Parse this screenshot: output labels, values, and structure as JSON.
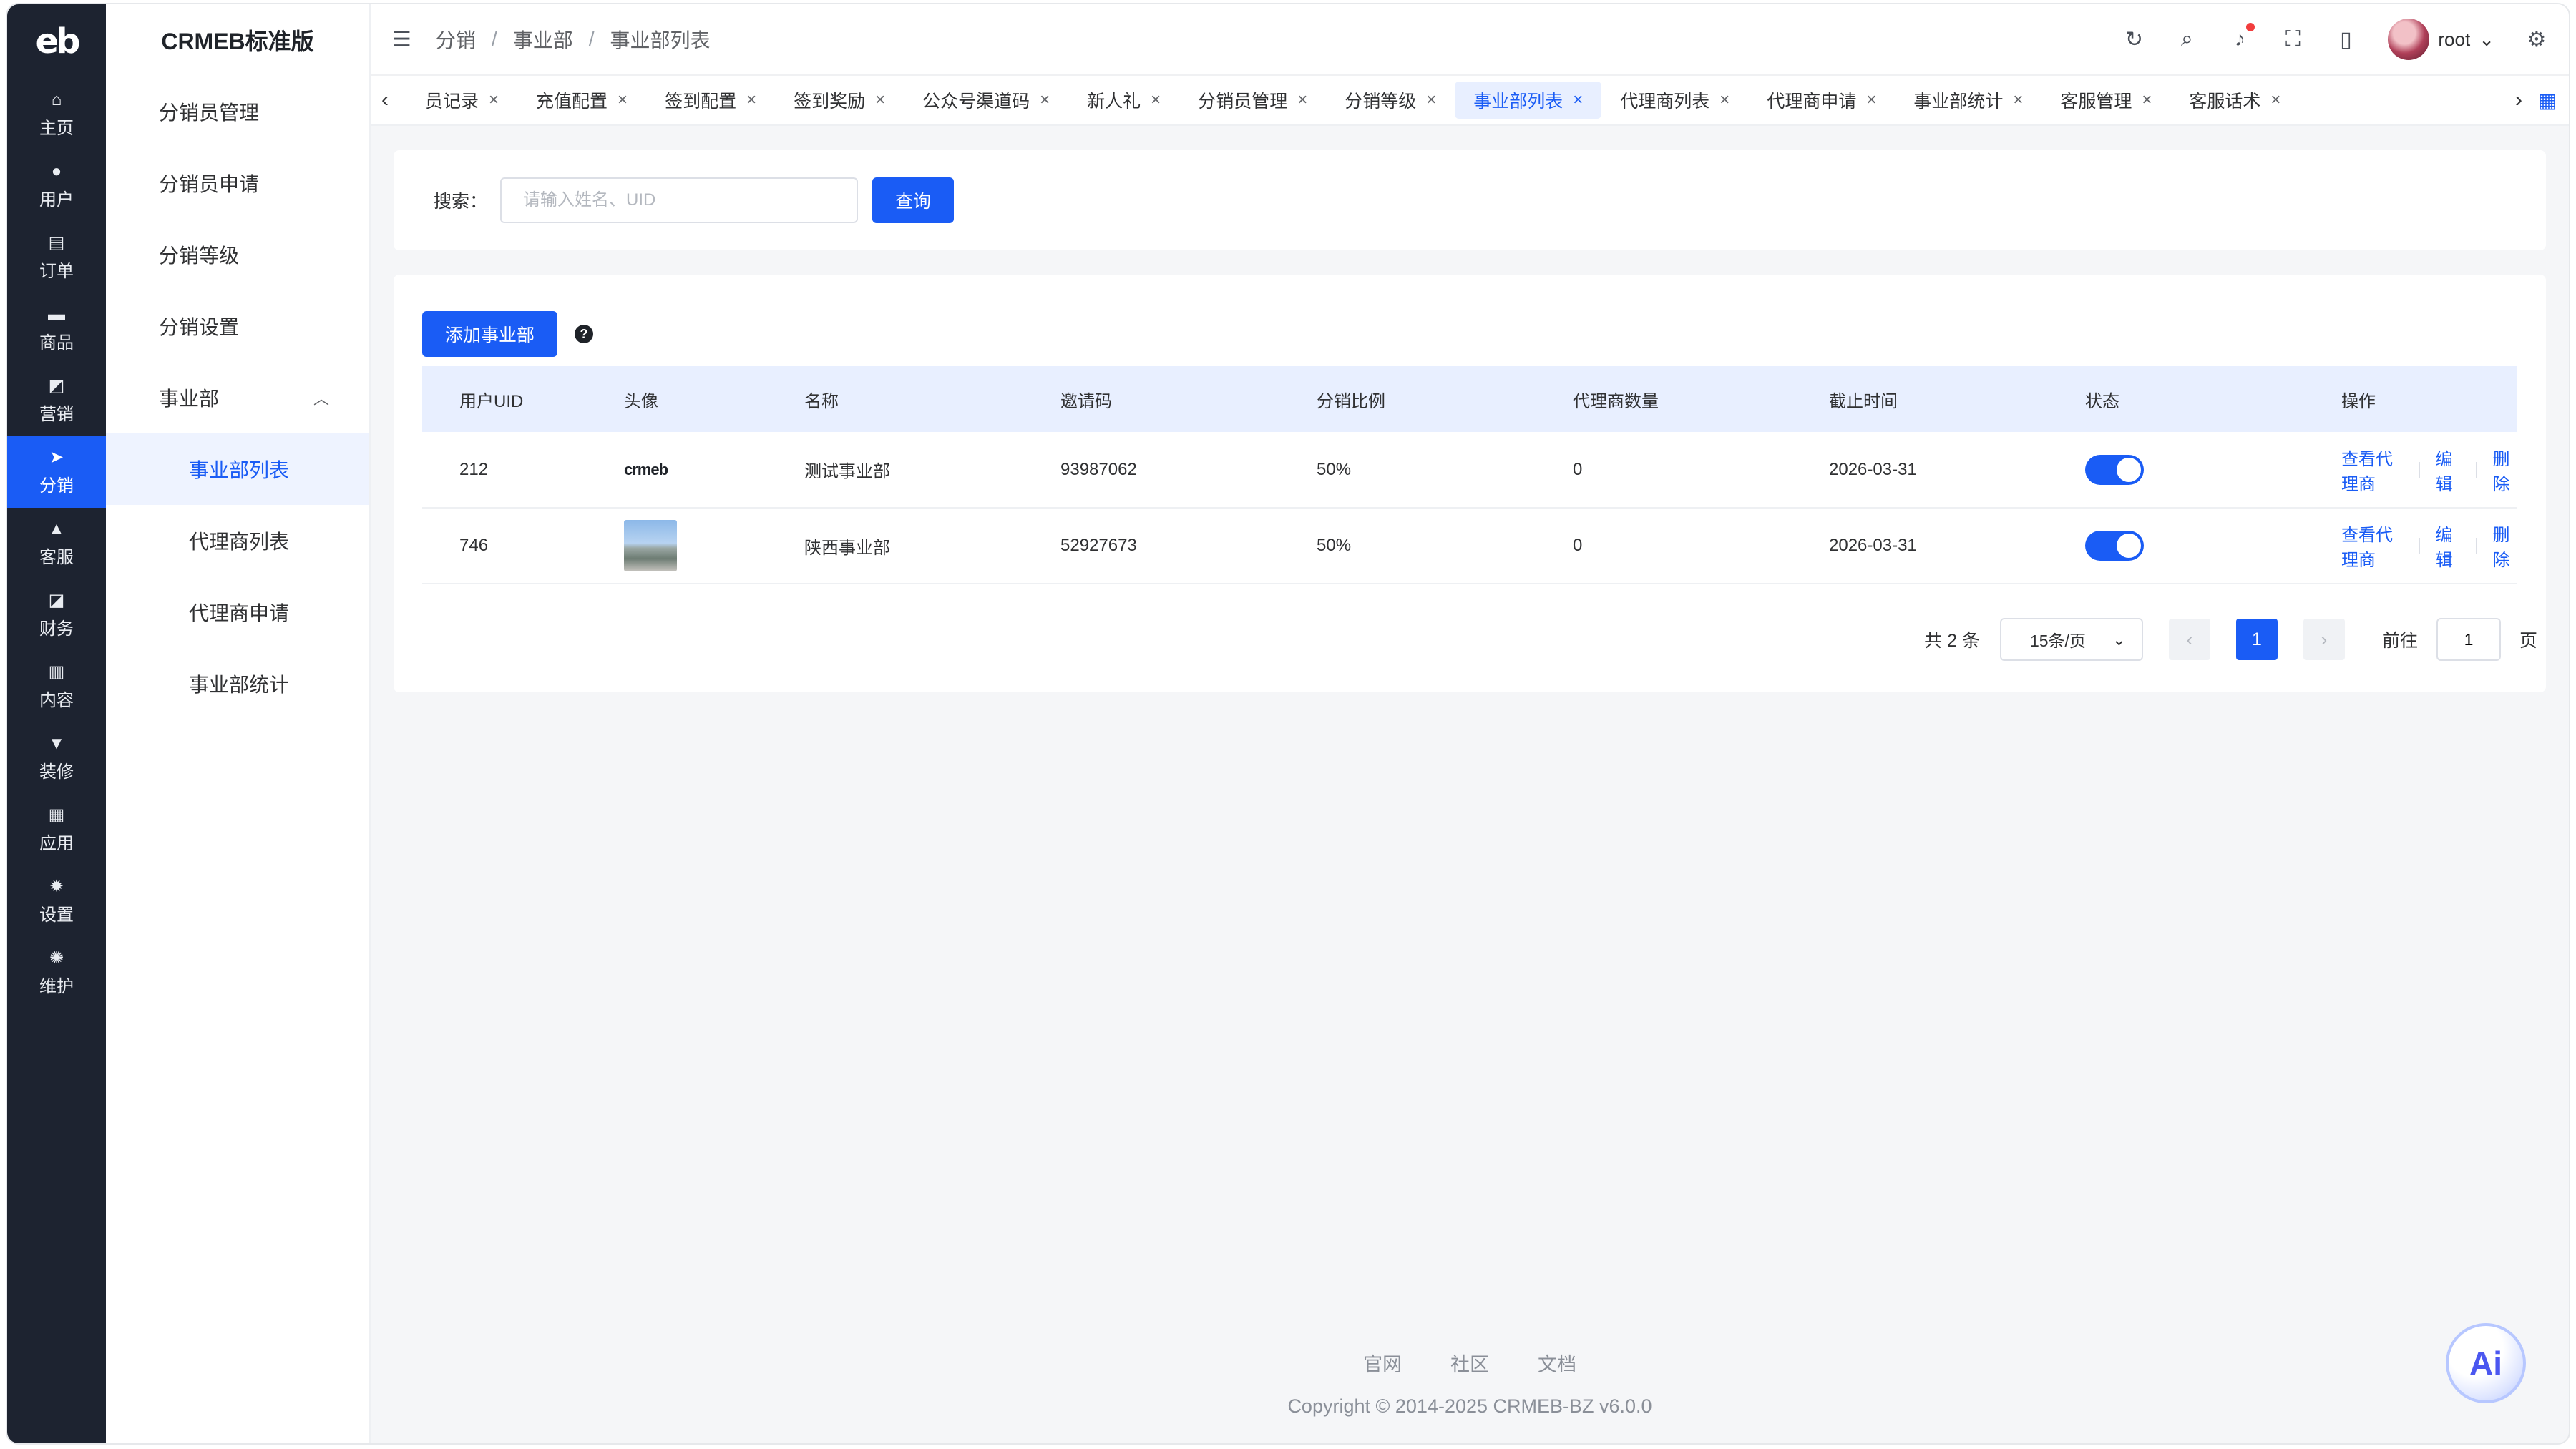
{
  "app": {
    "logo_text": "eb",
    "brand": "CRMEB标准版"
  },
  "rail": [
    {
      "icon": "home-icon",
      "glyph": "⌂",
      "label": "主页"
    },
    {
      "icon": "user-icon",
      "glyph": "●",
      "label": "用户"
    },
    {
      "icon": "order-icon",
      "glyph": "▤",
      "label": "订单"
    },
    {
      "icon": "product-icon",
      "glyph": "▬",
      "label": "商品"
    },
    {
      "icon": "marketing-icon",
      "glyph": "◩",
      "label": "营销"
    },
    {
      "icon": "distribution-icon",
      "glyph": "➤",
      "label": "分销"
    },
    {
      "icon": "service-icon",
      "glyph": "▲",
      "label": "客服"
    },
    {
      "icon": "finance-icon",
      "glyph": "◪",
      "label": "财务"
    },
    {
      "icon": "content-icon",
      "glyph": "▥",
      "label": "内容"
    },
    {
      "icon": "decorate-icon",
      "glyph": "▼",
      "label": "装修"
    },
    {
      "icon": "apps-icon",
      "glyph": "▦",
      "label": "应用"
    },
    {
      "icon": "settings-icon",
      "glyph": "✹",
      "label": "设置"
    },
    {
      "icon": "maintenance-icon",
      "glyph": "✺",
      "label": "维护"
    }
  ],
  "submenu": {
    "items": [
      "分销员管理",
      "分销员申请",
      "分销等级",
      "分销设置"
    ],
    "group_label": "事业部",
    "sub_items": [
      "事业部列表",
      "代理商列表",
      "代理商申请",
      "事业部统计"
    ]
  },
  "header": {
    "breadcrumb": [
      "分销",
      "事业部",
      "事业部列表"
    ],
    "user_name": "root"
  },
  "tabs": [
    {
      "label": "员记录"
    },
    {
      "label": "充值配置"
    },
    {
      "label": "签到配置"
    },
    {
      "label": "签到奖励"
    },
    {
      "label": "公众号渠道码"
    },
    {
      "label": "新人礼"
    },
    {
      "label": "分销员管理"
    },
    {
      "label": "分销等级"
    },
    {
      "label": "事业部列表"
    },
    {
      "label": "代理商列表"
    },
    {
      "label": "代理商申请"
    },
    {
      "label": "事业部统计"
    },
    {
      "label": "客服管理"
    },
    {
      "label": "客服话术"
    }
  ],
  "search": {
    "label": "搜索：",
    "placeholder": "请输入姓名、UID",
    "button": "查询"
  },
  "toolbar": {
    "add_button": "添加事业部",
    "help": "?"
  },
  "table": {
    "columns": [
      "用户UID",
      "头像",
      "名称",
      "邀请码",
      "分销比例",
      "代理商数量",
      "截止时间",
      "状态",
      "操作"
    ],
    "rows": [
      {
        "uid": "212",
        "avatar": "crmeb",
        "name": "测试事业部",
        "code": "93987062",
        "ratio": "50%",
        "count": "0",
        "deadline": "2026-03-31",
        "status": "on"
      },
      {
        "uid": "746",
        "avatar": "photo",
        "name": "陕西事业部",
        "code": "52927673",
        "ratio": "50%",
        "count": "0",
        "deadline": "2026-03-31",
        "status": "on"
      }
    ],
    "ops": [
      "查看代理商",
      "编辑",
      "删除"
    ]
  },
  "pagination": {
    "total": "共 2 条",
    "page_size": "15条/页",
    "current": "1",
    "goto_label": "前往",
    "goto_value": "1",
    "page_suffix": "页"
  },
  "footer": {
    "links": [
      "官网",
      "社区",
      "文档"
    ],
    "copyright": "Copyright © 2014-2025 CRMEB-BZ v6.0.0"
  },
  "ai_button": "Ai",
  "colors": {
    "primary": "#1a5cf5",
    "rail_bg": "#1d2330"
  }
}
